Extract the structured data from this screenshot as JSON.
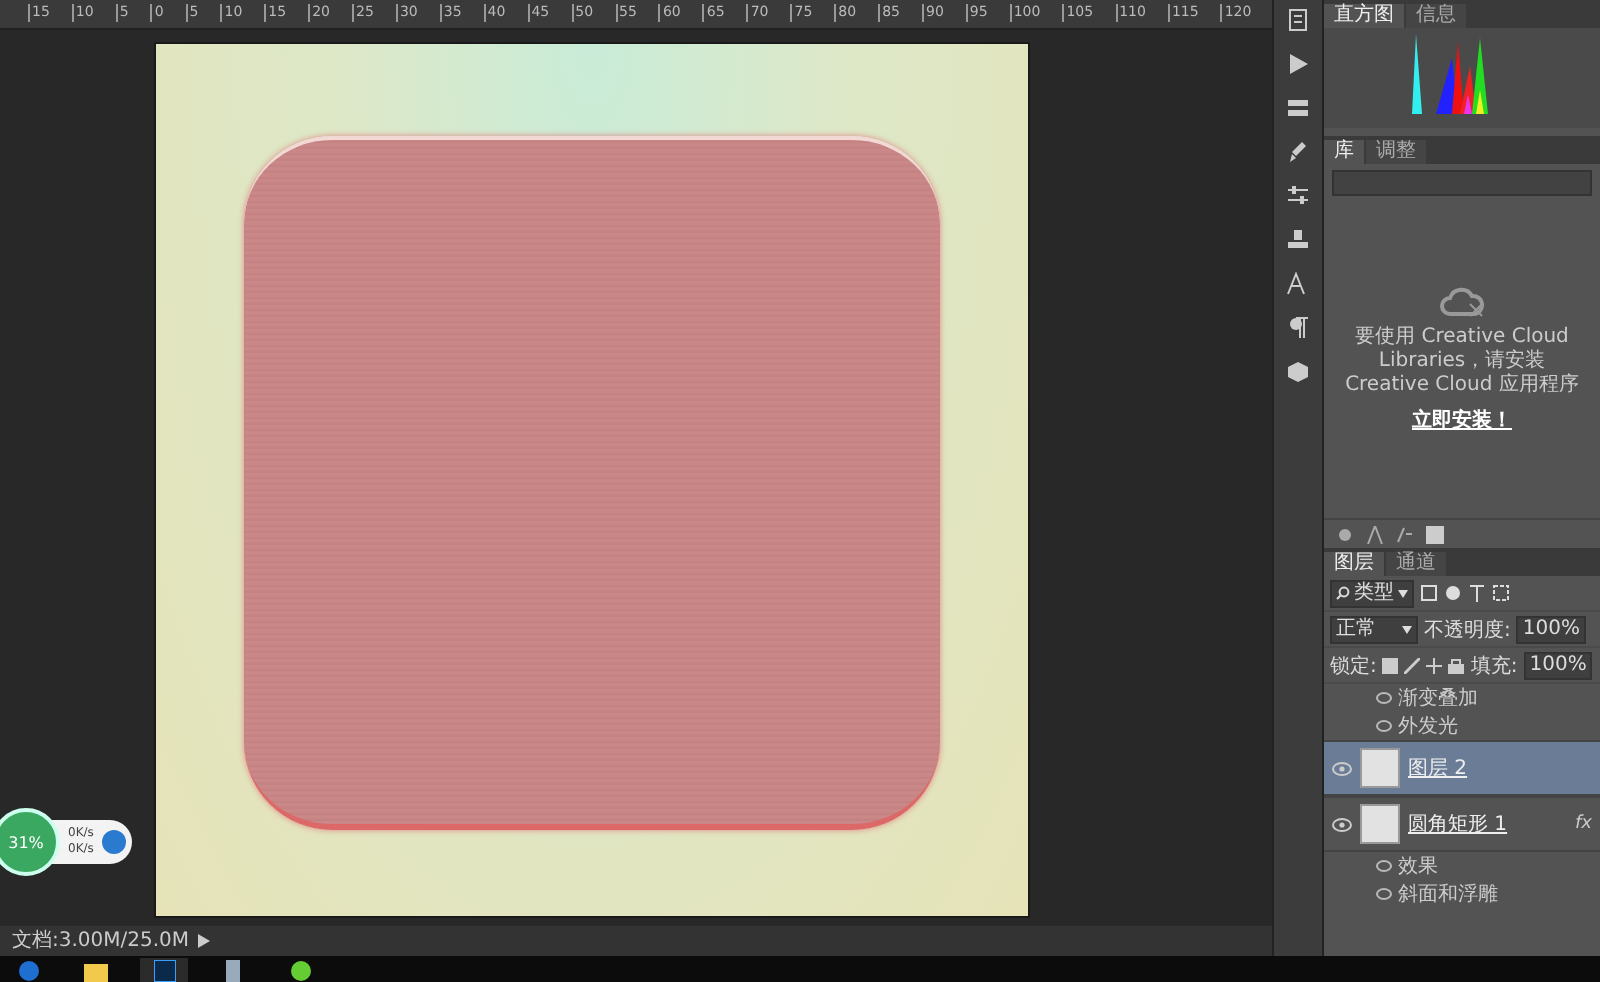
{
  "ruler": {
    "ticks": [
      "15",
      "10",
      "5",
      "0",
      "5",
      "10",
      "15",
      "20",
      "25",
      "30",
      "35",
      "40",
      "45",
      "50",
      "55",
      "60",
      "65",
      "70",
      "75",
      "80",
      "85",
      "90",
      "95",
      "100",
      "105",
      "110",
      "115",
      "120"
    ]
  },
  "speed_widget": {
    "percent": "31%",
    "upload": "0K/s",
    "download": "0K/s"
  },
  "status_bar": {
    "document_size": "文档:3.00M/25.0M"
  },
  "histogram_panel": {
    "tabs": [
      {
        "label": "直方图",
        "selected": true
      },
      {
        "label": "信息",
        "selected": false
      }
    ]
  },
  "library_panel": {
    "tabs": [
      {
        "label": "库",
        "selected": true
      },
      {
        "label": "调整",
        "selected": false
      }
    ],
    "message": "要使用 Creative Cloud Libraries，请安装 Creative Cloud 应用程序",
    "install_link": "立即安装！"
  },
  "layers_panel": {
    "tabs": [
      {
        "label": "图层",
        "selected": true
      },
      {
        "label": "通道",
        "selected": false
      }
    ],
    "filter": "类型",
    "blend_mode": "正常",
    "opacity_label": "不透明度:",
    "opacity": "100%",
    "lock_label": "锁定:",
    "fill_label": "填充:",
    "fill": "100%",
    "layers": [
      {
        "kind": "effect",
        "label": "渐变叠加"
      },
      {
        "kind": "effect",
        "label": "外发光"
      },
      {
        "kind": "layer",
        "label": "图层 2",
        "selected": true,
        "visible": true
      },
      {
        "kind": "layer",
        "label": "圆角矩形 1",
        "selected": false,
        "visible": true,
        "badge": "fx"
      },
      {
        "kind": "effect",
        "label": "效果"
      },
      {
        "kind": "effect",
        "label": "斜面和浮雕"
      }
    ]
  },
  "taskbar": {
    "items": [
      {
        "kind": "start",
        "selected": false
      },
      {
        "kind": "folder",
        "selected": false
      },
      {
        "kind": "photoshop",
        "selected": true
      },
      {
        "kind": "tool",
        "selected": false
      },
      {
        "kind": "green",
        "selected": false
      }
    ]
  }
}
